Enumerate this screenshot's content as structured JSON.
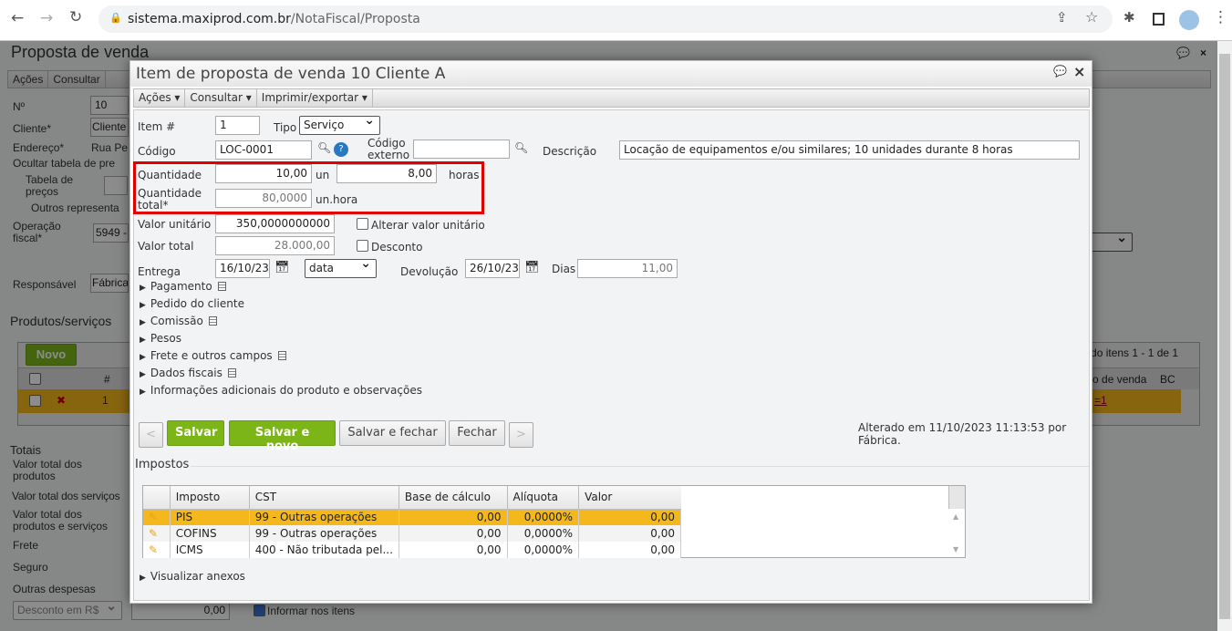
{
  "browser": {
    "url_host": "sistema.maxiprod.com.br",
    "url_path": "/NotaFiscal/Proposta",
    "icons": [
      "back-icon",
      "forward-icon",
      "reload-icon",
      "lock-icon",
      "share-icon",
      "star-icon",
      "extensions-icon",
      "sidepanel-icon",
      "profile-avatar",
      "menu-icon"
    ]
  },
  "background": {
    "title": "Proposta de venda",
    "menu": [
      "Ações",
      "Consultar"
    ],
    "fields": {
      "numero_label": "Nº",
      "numero": "10",
      "cliente_label": "Cliente*",
      "cliente": "Cliente",
      "endereco_label": "Endereço*",
      "endereco": "Rua Pe",
      "ocultar": "Ocultar tabela de pre",
      "tabela_label": "Tabela de preços",
      "outros": "Outros representa",
      "operacao_label": "Operação fiscal*",
      "operacao": "5949 -",
      "responsavel_label": "Responsável",
      "responsavel": "Fábrica"
    },
    "produtos_title": "Produtos/serviços",
    "novo": "Novo",
    "grid_info": "bindo itens 1 - 1 de 1",
    "grid_cols": [
      "#",
      "dido de venda",
      "BC"
    ],
    "grid_row": {
      "num": "1",
      "link": "=1"
    },
    "totais_title": "Totais",
    "totais": [
      "Valor total dos produtos",
      "Valor total dos serviços",
      "Valor total dos produtos e serviços",
      "Frete",
      "Seguro",
      "Outras despesas"
    ],
    "desconto_select": "Desconto em R$",
    "desconto_value": "0,00",
    "informar": "Informar nos itens"
  },
  "modal": {
    "title": "Item de proposta de venda 10 Cliente A",
    "menu": [
      "Ações",
      "Consultar",
      "Imprimir/exportar"
    ],
    "item_label": "Item #",
    "item": "1",
    "tipo_label": "Tipo",
    "tipo": "Serviço",
    "codigo_label": "Código",
    "codigo": "LOC-0001",
    "codigo_externo_label": "Código externo",
    "codigo_externo": "",
    "descricao_label": "Descrição",
    "descricao": "Locação de equipamentos e/ou similares; 10 unidades durante 8 horas",
    "quantidade_label": "Quantidade",
    "quantidade": "10,00",
    "quantidade_unit": "un",
    "quantidade2": "8,00",
    "quantidade2_unit": "horas",
    "quantidade_total_label": "Quantidade total*",
    "quantidade_total": "80,0000",
    "quantidade_total_unit": "un.hora",
    "valor_unitario_label": "Valor unitário",
    "valor_unitario": "350,0000000000",
    "alterar_label": "Alterar valor unitário",
    "valor_total_label": "Valor total",
    "valor_total": "28.000,00",
    "desconto_label": "Desconto",
    "entrega_label": "Entrega",
    "entrega": "16/10/23",
    "entrega_tipo": "data",
    "devolucao_label": "Devolução",
    "devolucao": "26/10/23",
    "dias_label": "Dias",
    "dias": "11,00",
    "sections": [
      "Pagamento",
      "Pedido do cliente",
      "Comissão",
      "Pesos",
      "Frete e outros campos",
      "Dados fiscais",
      "Informações adicionais do produto e observações"
    ],
    "buttons": {
      "prev": "<",
      "salvar": "Salvar",
      "salvar_novo": "Salvar e novo",
      "salvar_fechar": "Salvar e fechar",
      "fechar": "Fechar",
      "next": ">"
    },
    "alterado": "Alterado em 11/10/2023 11:13:53 por Fábrica.",
    "impostos_title": "Impostos",
    "tax_cols": [
      "Imposto",
      "CST",
      "Base de cálculo",
      "Alíquota",
      "Valor"
    ],
    "tax_rows": [
      {
        "imposto": "PIS",
        "cst": "99 - Outras operações",
        "base": "0,00",
        "aliquota": "0,0000%",
        "valor": "0,00"
      },
      {
        "imposto": "COFINS",
        "cst": "99 - Outras operações",
        "base": "0,00",
        "aliquota": "0,0000%",
        "valor": "0,00"
      },
      {
        "imposto": "ICMS",
        "cst": "400 - Não tributada pel...",
        "base": "0,00",
        "aliquota": "0,0000%",
        "valor": "0,00"
      }
    ],
    "anexos": "Visualizar anexos"
  },
  "colors": {
    "accent_green": "#7cb518",
    "selected_row": "#f5b81c",
    "highlight_box": "#e00000"
  }
}
